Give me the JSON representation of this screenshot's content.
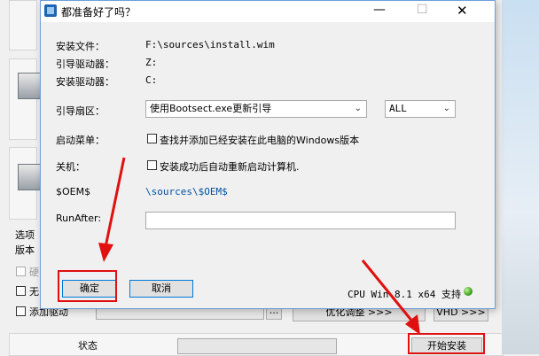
{
  "dialog": {
    "title": "都准备好了吗？",
    "fields": {
      "install_file_label": "安装文件：",
      "install_file_value": "F:\\sources\\install.wim",
      "boot_drive_label": "引导驱动器：",
      "boot_drive_value": "Z:",
      "install_drive_label": "安装驱动器：",
      "install_drive_value": "C:",
      "boot_sector_label": "引导扇区：",
      "boot_sector_value": "使用Bootsect.exe更新引导",
      "boot_sector_scope": "ALL",
      "boot_menu_label": "启动菜单：",
      "boot_menu_checkbox": "查找并添加已经安装在此电脑的Windows版本",
      "shutdown_label": "关机：",
      "shutdown_checkbox": "安装成功后自动重新启动计算机.",
      "oem_label": "$OEM$",
      "oem_value": "\\sources\\$OEM$",
      "runafter_label": "RunAfter:",
      "runafter_value": ""
    },
    "ok_label": "确定",
    "cancel_label": "取消",
    "cpu_status": "CPU Win 8.1 x64 支持"
  },
  "background": {
    "options_label": "选项",
    "version_label": "版本",
    "hard_label": "硬",
    "no_label": "无",
    "add_driver_label": "添加驱动",
    "browse_label": "...",
    "optimize_label": "优化调整 >>>",
    "vhd_label": "VHD >>>",
    "status_label": "状态",
    "start_install_label": "开始安装"
  },
  "colors": {
    "annotation_red": "#e01010",
    "title_blue": "#0050a0"
  }
}
